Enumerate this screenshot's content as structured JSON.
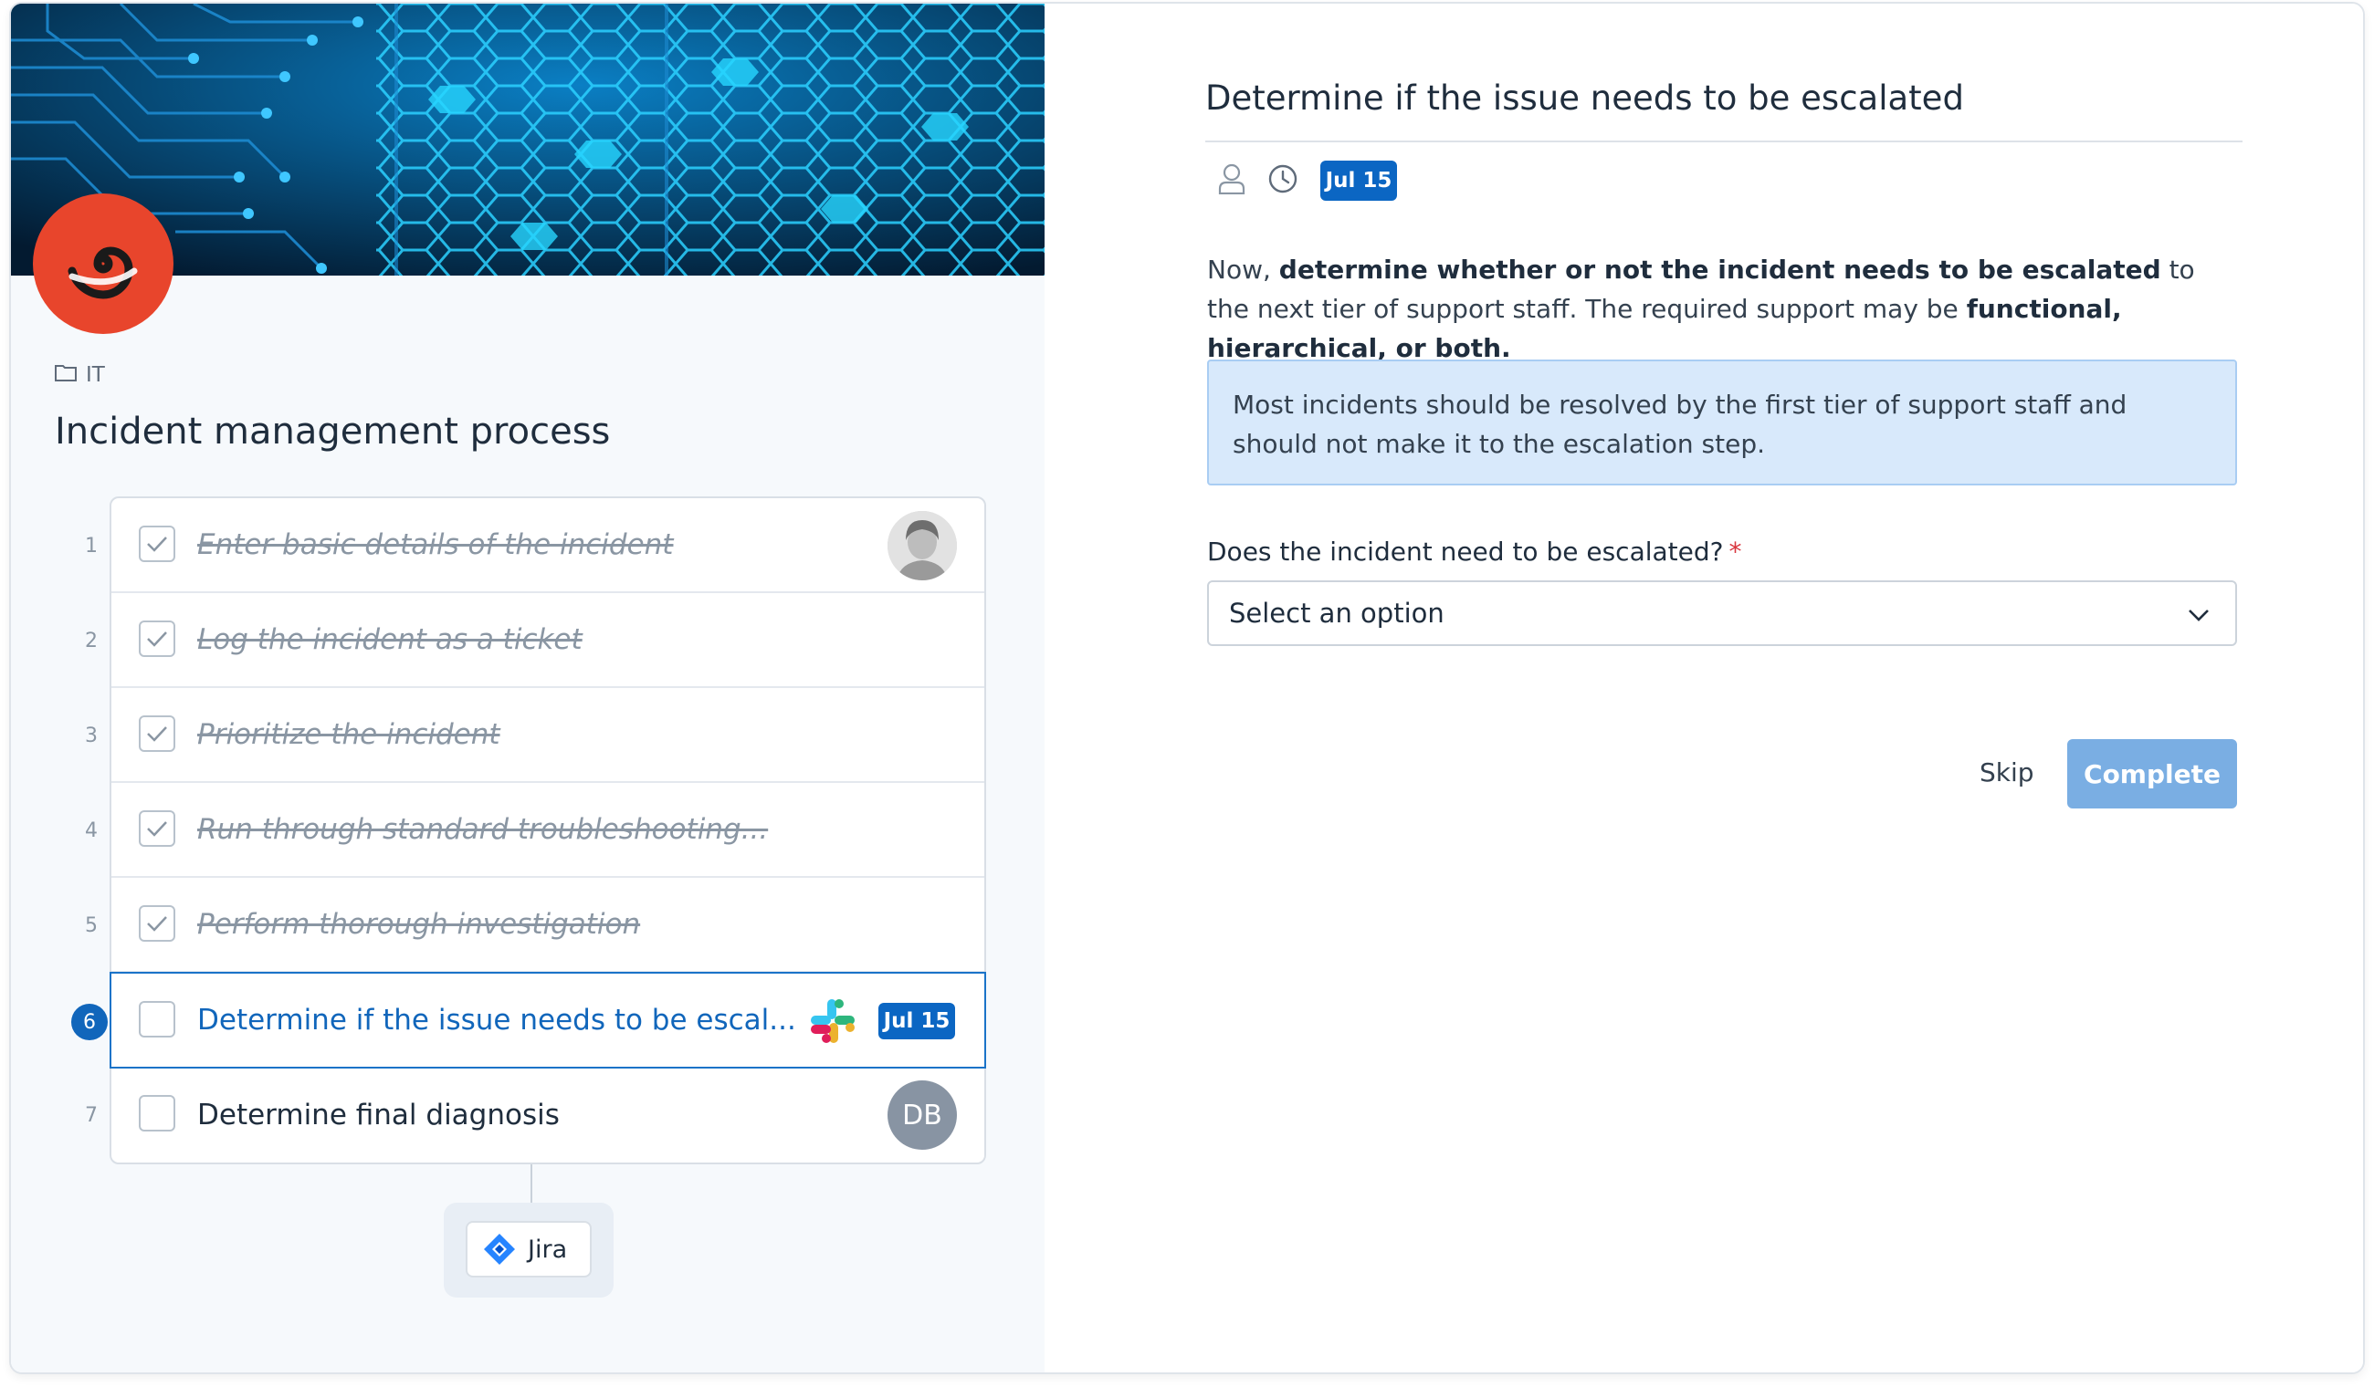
{
  "checklist": {
    "folder": "IT",
    "title": "Incident management process",
    "tasks": [
      {
        "number": "1",
        "label": "Enter basic details of the incident",
        "done": true,
        "assignee": "photo"
      },
      {
        "number": "2",
        "label": "Log the incident as a ticket",
        "done": true
      },
      {
        "number": "3",
        "label": "Prioritize the incident",
        "done": true
      },
      {
        "number": "4",
        "label": "Run through standard troubleshooting...",
        "done": true
      },
      {
        "number": "5",
        "label": "Perform thorough investigation",
        "done": true
      },
      {
        "number": "6",
        "label": "Determine if the issue needs to be escal...",
        "done": false,
        "active": true,
        "integration": "slack-icon",
        "due": "Jul 15"
      },
      {
        "number": "7",
        "label": "Determine final diagnosis",
        "done": false,
        "assignee_initials": "DB"
      }
    ],
    "integration": {
      "label": "Jira",
      "icon": "jira-icon"
    }
  },
  "task_detail": {
    "title": "Determine if the issue needs to be escalated",
    "due_badge": "Jul 15",
    "description": {
      "p1": "Now, ",
      "b1": "determine whether or not the incident needs to be escalated",
      "p2": " to the next tier of support staff. The required support may be ",
      "b2": "functional, hierarchical, or both."
    },
    "callout": "Most incidents should be resolved by the first tier of support staff and should not make it to the escalation step.",
    "question": {
      "label": "Does the incident need to be escalated?",
      "required_mark": "*",
      "select_value": "Select an option"
    },
    "actions": {
      "skip": "Skip",
      "complete": "Complete"
    }
  },
  "colors": {
    "accent": "#0b66c3",
    "logo": "#e8452c",
    "callout_bg": "#d8e9fb",
    "complete_button": "#7aaee3"
  }
}
